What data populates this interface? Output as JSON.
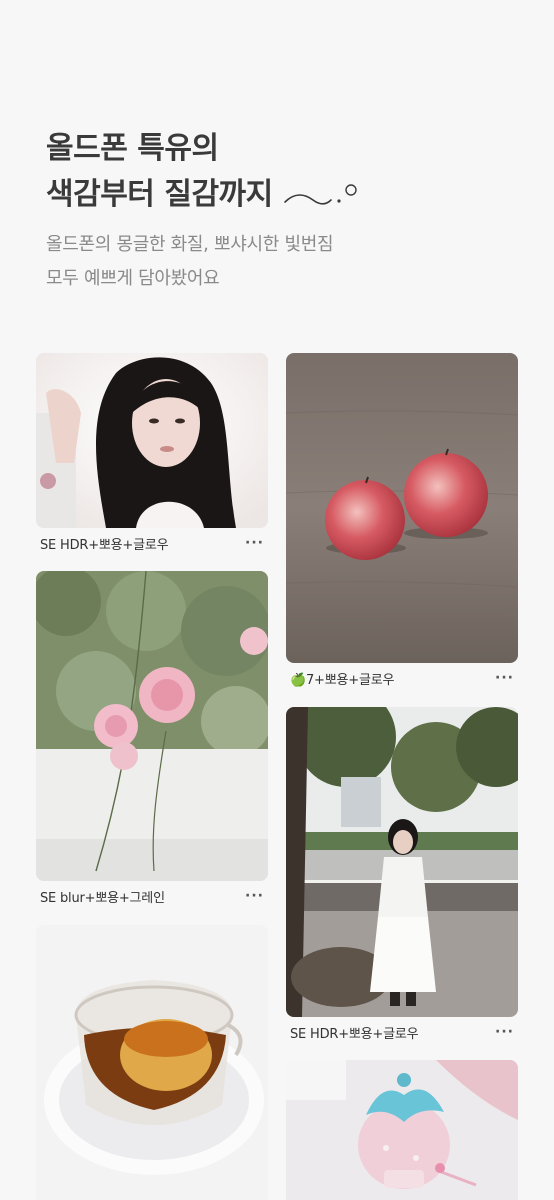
{
  "hero": {
    "title_line1": "올드폰 특유의",
    "title_line2": "색감부터 질감까지",
    "subtitle_line1": "올드폰의 몽글한 화질, 뽀샤시한 빛번짐",
    "subtitle_line2": "모두 예쁘게 담아봤어요"
  },
  "cards": [
    {
      "caption": "SE HDR+뽀용+글로우",
      "more": "···",
      "photo": "portrait-woman"
    },
    {
      "caption": "🍏7+뽀용+글로우",
      "more": "···",
      "photo": "two-apples"
    },
    {
      "caption": "SE blur+뽀용+그레인",
      "more": "···",
      "photo": "pink-roses"
    },
    {
      "caption": "SE HDR+뽀용+글로우",
      "more": "···",
      "photo": "woman-in-park"
    },
    {
      "caption": "",
      "more": "",
      "photo": "pudding-cup"
    },
    {
      "caption": "",
      "more": "",
      "photo": "strawberry-figure"
    }
  ],
  "colors": {
    "background": "#f7f7f8",
    "title": "#3a3a3a",
    "subtitle": "#8a8a8a"
  }
}
